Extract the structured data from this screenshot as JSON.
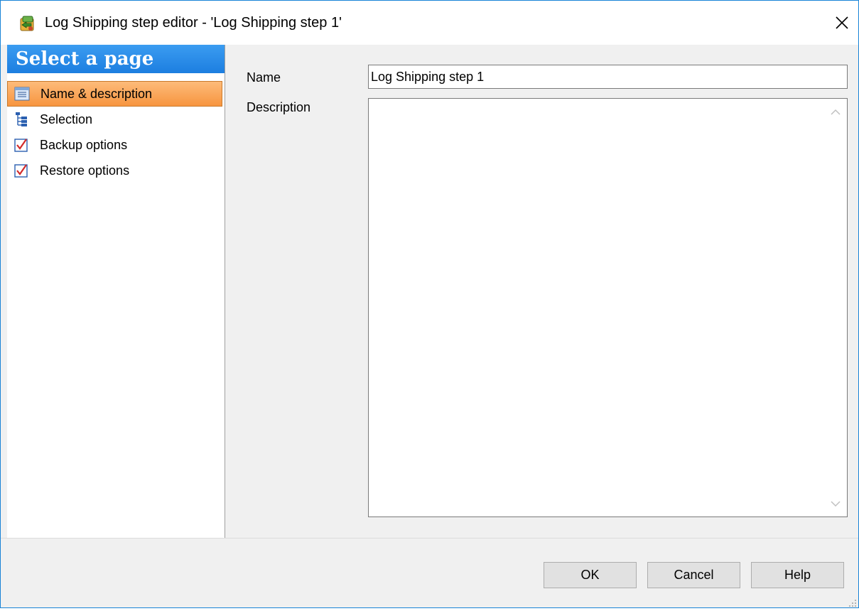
{
  "window": {
    "title": "Log Shipping step editor - 'Log Shipping step 1'",
    "title_icon": "app-icon",
    "close_glyph": "✕"
  },
  "sidebar": {
    "header": "Select a page",
    "items": [
      {
        "label": "Name & description",
        "icon": "document-list-icon",
        "active": true
      },
      {
        "label": "Selection",
        "icon": "tree-icon",
        "active": false
      },
      {
        "label": "Backup options",
        "icon": "checkbox-icon",
        "active": false
      },
      {
        "label": "Restore options",
        "icon": "checkbox-icon",
        "active": false
      }
    ]
  },
  "form": {
    "name_label": "Name",
    "name_value": "Log Shipping step 1",
    "description_label": "Description",
    "description_value": ""
  },
  "buttons": {
    "ok": "OK",
    "cancel": "Cancel",
    "help": "Help"
  },
  "colors": {
    "accent": "#1c7ee0",
    "active_item": "#f7953f"
  }
}
